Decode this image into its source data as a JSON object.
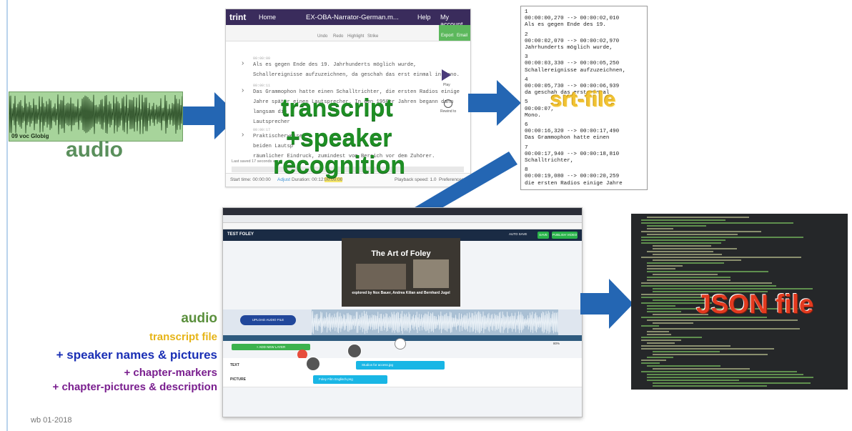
{
  "audio_block": {
    "waveform_caption": "09 voc Globig",
    "label": "audio"
  },
  "trint": {
    "logo": "trint",
    "home": "Home",
    "filename": "EX-OBA-Narrator-German.m...",
    "help": "Help",
    "account": "My account",
    "tools": [
      "Undo",
      "Redo",
      "Highlight",
      "Strike"
    ],
    "export": "Export",
    "email": "Email",
    "timestamps": [
      "00:00:00",
      "00:00:11",
      "00:00:17"
    ],
    "paragraphs": [
      "Als es gegen Ende des 19. Jahrhunderts möglich wurde,",
      "Schallereignisse aufzuzeichnen, da geschah das erst einmal in Mono.",
      "Das Grammophon hatte einen Schalltrichter, die ersten Radios einige",
      "Jahre später einen Lautsprecher. In den 1950er Jahren begann dann",
      "langsam die",
      "Lautsprecher",
      "Praktischerweise",
      "beiden Lautsp",
      "räumlicher Eindruck, zumindest vom Bereich vor dem Zuhörer."
    ],
    "play_label": "Play",
    "rewind_label": "Rewind to",
    "last_saved": "Last saved 17 seconds ago",
    "start_time": "Start time: 00:00:00",
    "adjust": "Adjust",
    "duration": "Duration: 00:12:59",
    "highlights": "00:00:00",
    "playback_speed": "Playback speed: 1.0",
    "preferences": "Preferences"
  },
  "trint_overlay": {
    "line1": "transcript",
    "line2": "+speaker",
    "line3": "recognition"
  },
  "srt": {
    "blocks": [
      {
        "num": "1",
        "time": "00:00:00,270 --> 00:00:02,010",
        "text": "Als es gegen Ende des 19."
      },
      {
        "num": "2",
        "time": "00:00:02,070 --> 00:00:02,970",
        "text": "Jahrhunderts möglich wurde,"
      },
      {
        "num": "3",
        "time": "00:00:03,330 --> 00:00:05,250",
        "text": "Schallereignisse aufzuzeichnen,"
      },
      {
        "num": "4",
        "time": "00:00:05,730 --> 00:00:06,939",
        "text": "da geschah das erst einmal"
      },
      {
        "num": "5",
        "time": "00:00:07,",
        "text": "Mono."
      },
      {
        "num": "6",
        "time": "00:00:16,320 --> 00:00:17,490",
        "text": "Das Grammophon hatte einen"
      },
      {
        "num": "7",
        "time": "00:00:17,940 --> 00:00:18,810",
        "text": "Schalltrichter,"
      },
      {
        "num": "8",
        "time": "00:00:19,080 --> 00:00:20,259",
        "text": "die ersten Radios einige Jahre"
      }
    ],
    "label": "srt-file"
  },
  "browser": {
    "project_title": "TEST FOLEY",
    "auto_save": "AUTO SAVE",
    "save": "SAVE",
    "publish": "PUBLISH VIDEO",
    "video_title": "The Art of Foley",
    "video_credits": "explored by Nox Bauer, Andrea Kilian and Bernhard Jugel",
    "upload_btn": "UPLOAD AUDIO FILE",
    "add_layer": "+ ADD NEW LAYER",
    "row_text": "TEXT",
    "row_picture": "PICTURE",
    "chip_text": "Studios for access.jpg",
    "chip_picture": "Foley Film Englisch.png",
    "zoom": "80%"
  },
  "json_label": "JSON file",
  "legend": [
    {
      "text": "audio",
      "color": "#5a8f3c"
    },
    {
      "text": "transcript file",
      "color": "#e6b417"
    },
    {
      "text": "+ speaker names & pictures",
      "color": "#1a2fb5"
    },
    {
      "text": "+ chapter-markers",
      "color": "#7a1f8f"
    },
    {
      "text": "+ chapter-pictures & description",
      "color": "#7a1f8f"
    }
  ],
  "footer": "wb 01-2018",
  "colors": {
    "arrow_blue": "#2466b3",
    "audio_green": "#5a8f5c",
    "transcript_green": "#1f8f25",
    "srt_yellow": "#f1c232",
    "json_red": "#e23a1f"
  }
}
